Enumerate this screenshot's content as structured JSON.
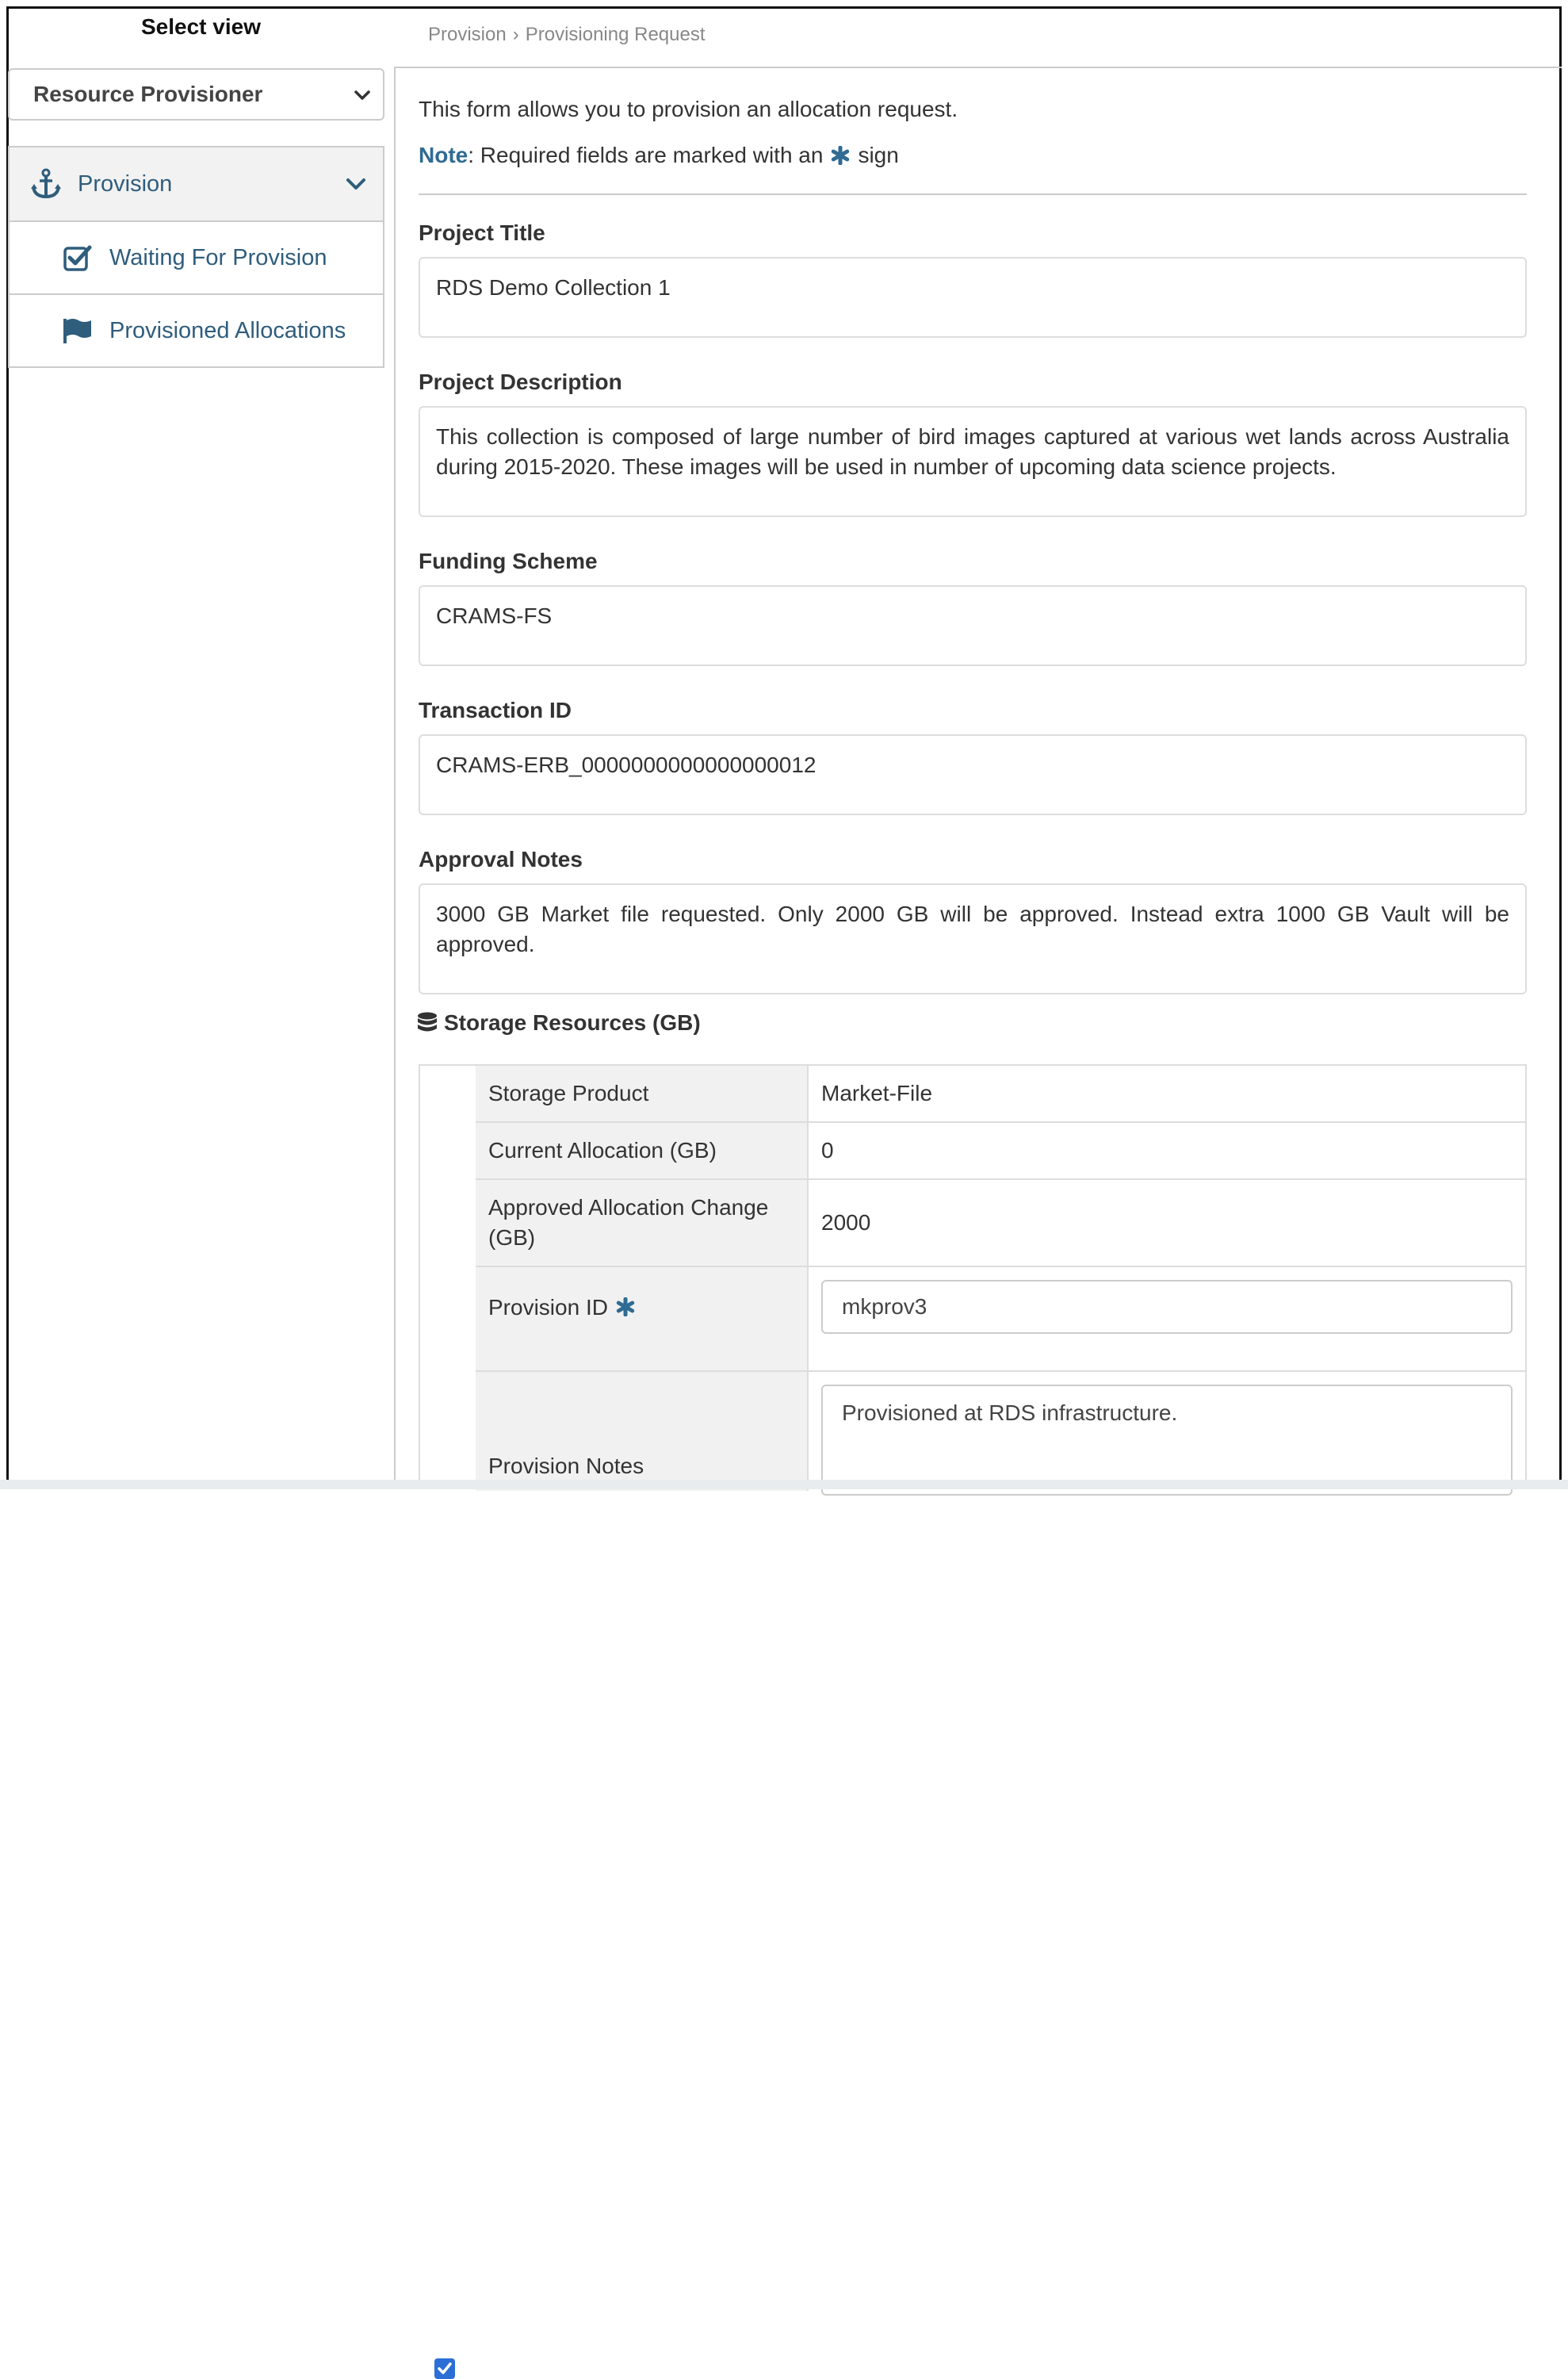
{
  "sidebar": {
    "title": "Select view",
    "role_select": {
      "value": "Resource Provisioner"
    },
    "menu": [
      {
        "label": "Provision",
        "icon": "anchor-icon"
      },
      {
        "label": "Waiting For Provision",
        "icon": "check-square-icon"
      },
      {
        "label": "Provisioned Allocations",
        "icon": "flag-icon"
      }
    ]
  },
  "breadcrumb": {
    "root": "Provision",
    "separator": "›",
    "current": "Provisioning Request"
  },
  "form": {
    "intro": "This form allows you to provision an allocation request.",
    "note_label": "Note",
    "note_text_before": ": Required fields are marked with an",
    "note_text_after": "sign",
    "fields": {
      "project_title": {
        "label": "Project Title",
        "value": "RDS Demo Collection 1"
      },
      "project_description": {
        "label": "Project Description",
        "value": "This collection is composed of large number of bird images captured at various wet lands across Australia during 2015-2020. These images will be used in number of upcoming data science projects."
      },
      "funding_scheme": {
        "label": "Funding Scheme",
        "value": "CRAMS-FS"
      },
      "transaction_id": {
        "label": "Transaction ID",
        "value": "CRAMS-ERB_0000000000000000012"
      },
      "approval_notes": {
        "label": "Approval Notes",
        "value": "3000 GB Market file requested. Only 2000 GB will be approved. Instead extra 1000 GB Vault will be approved."
      }
    },
    "storage": {
      "title": "Storage Resources (GB)",
      "rows": {
        "storage_product": {
          "label": "Storage Product",
          "value": "Market-File"
        },
        "current_allocation": {
          "label": "Current Allocation (GB)",
          "value": "0"
        },
        "approved_change": {
          "label": "Approved Allocation Change (GB)",
          "value": "2000"
        },
        "provision_id": {
          "label": "Provision ID",
          "value": "mkprov3",
          "checked": true
        },
        "provision_notes": {
          "label": "Provision Notes",
          "value": "Provisioned at RDS infrastructure."
        }
      }
    }
  },
  "colors": {
    "link": "#2f5d7c",
    "accent": "#2f6b93",
    "checkbox": "#2b6fd6"
  }
}
